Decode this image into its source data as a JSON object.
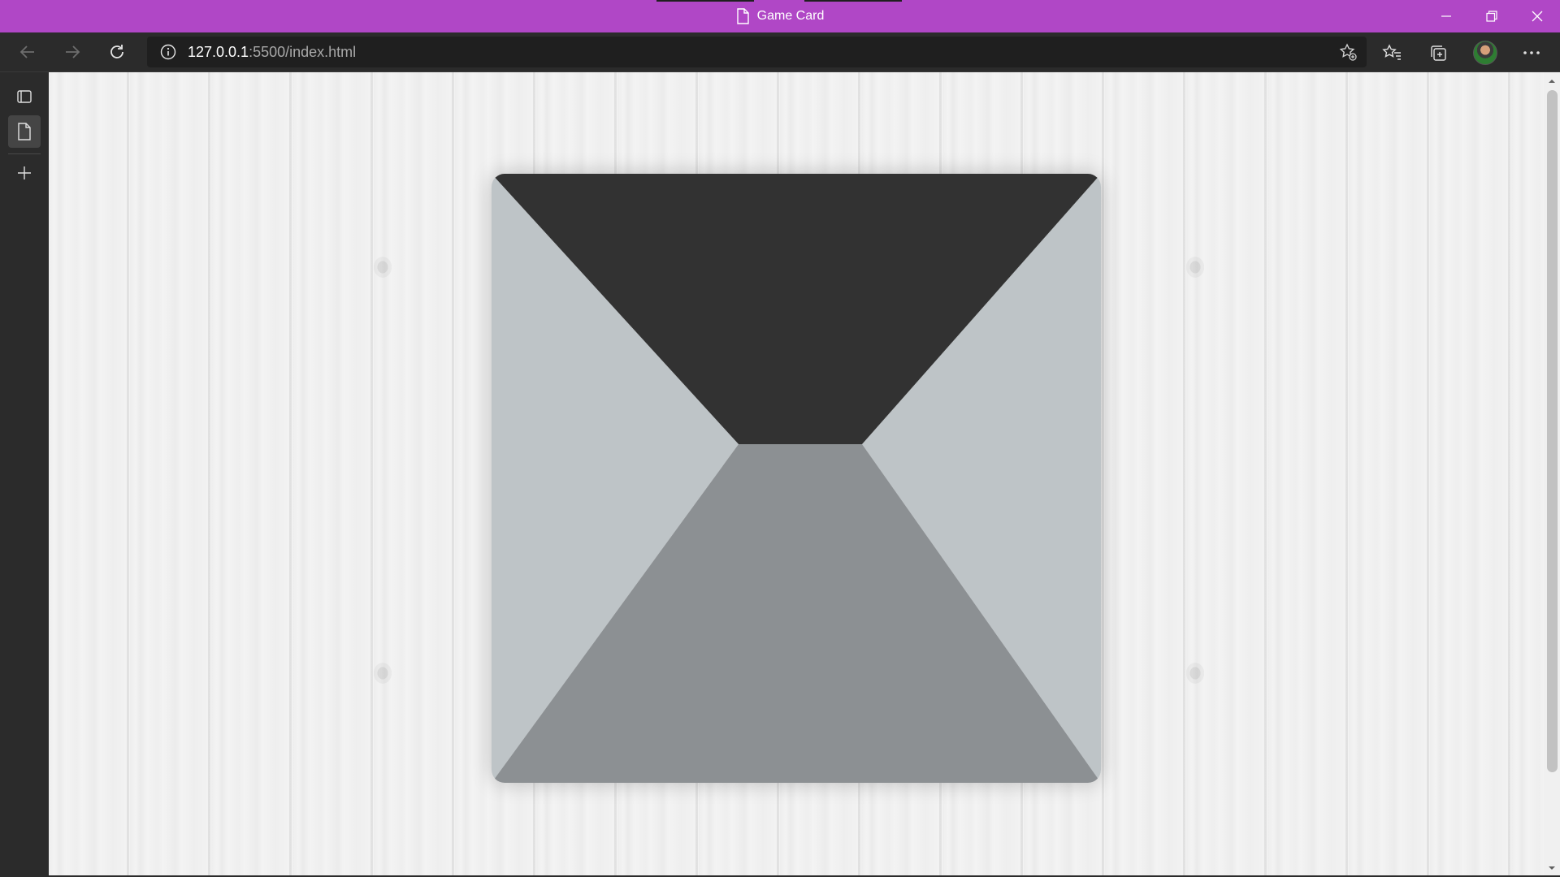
{
  "window": {
    "title": "Game Card",
    "title_bar_color": "#b047c6",
    "controls": [
      "minimize-icon",
      "restore-icon",
      "close-icon"
    ]
  },
  "toolbar": {
    "url_host": "127.0.0.1",
    "url_rest": ":5500/index.html",
    "icons": [
      "back-arrow-icon",
      "forward-arrow-icon",
      "refresh-icon",
      "info-icon",
      "add-favorite-icon",
      "favorites-icon",
      "collections-icon",
      "profile-avatar",
      "more-icon"
    ]
  },
  "sidebar": {
    "icons": [
      "tab-actions-icon",
      "page-tab-icon",
      "new-tab-icon"
    ]
  },
  "card": {
    "colors": {
      "top": "#323232",
      "left": "#bec4c7",
      "right": "#bec4c7",
      "bottom": "#8c9093"
    }
  },
  "page": {
    "background": "white wood planks"
  }
}
